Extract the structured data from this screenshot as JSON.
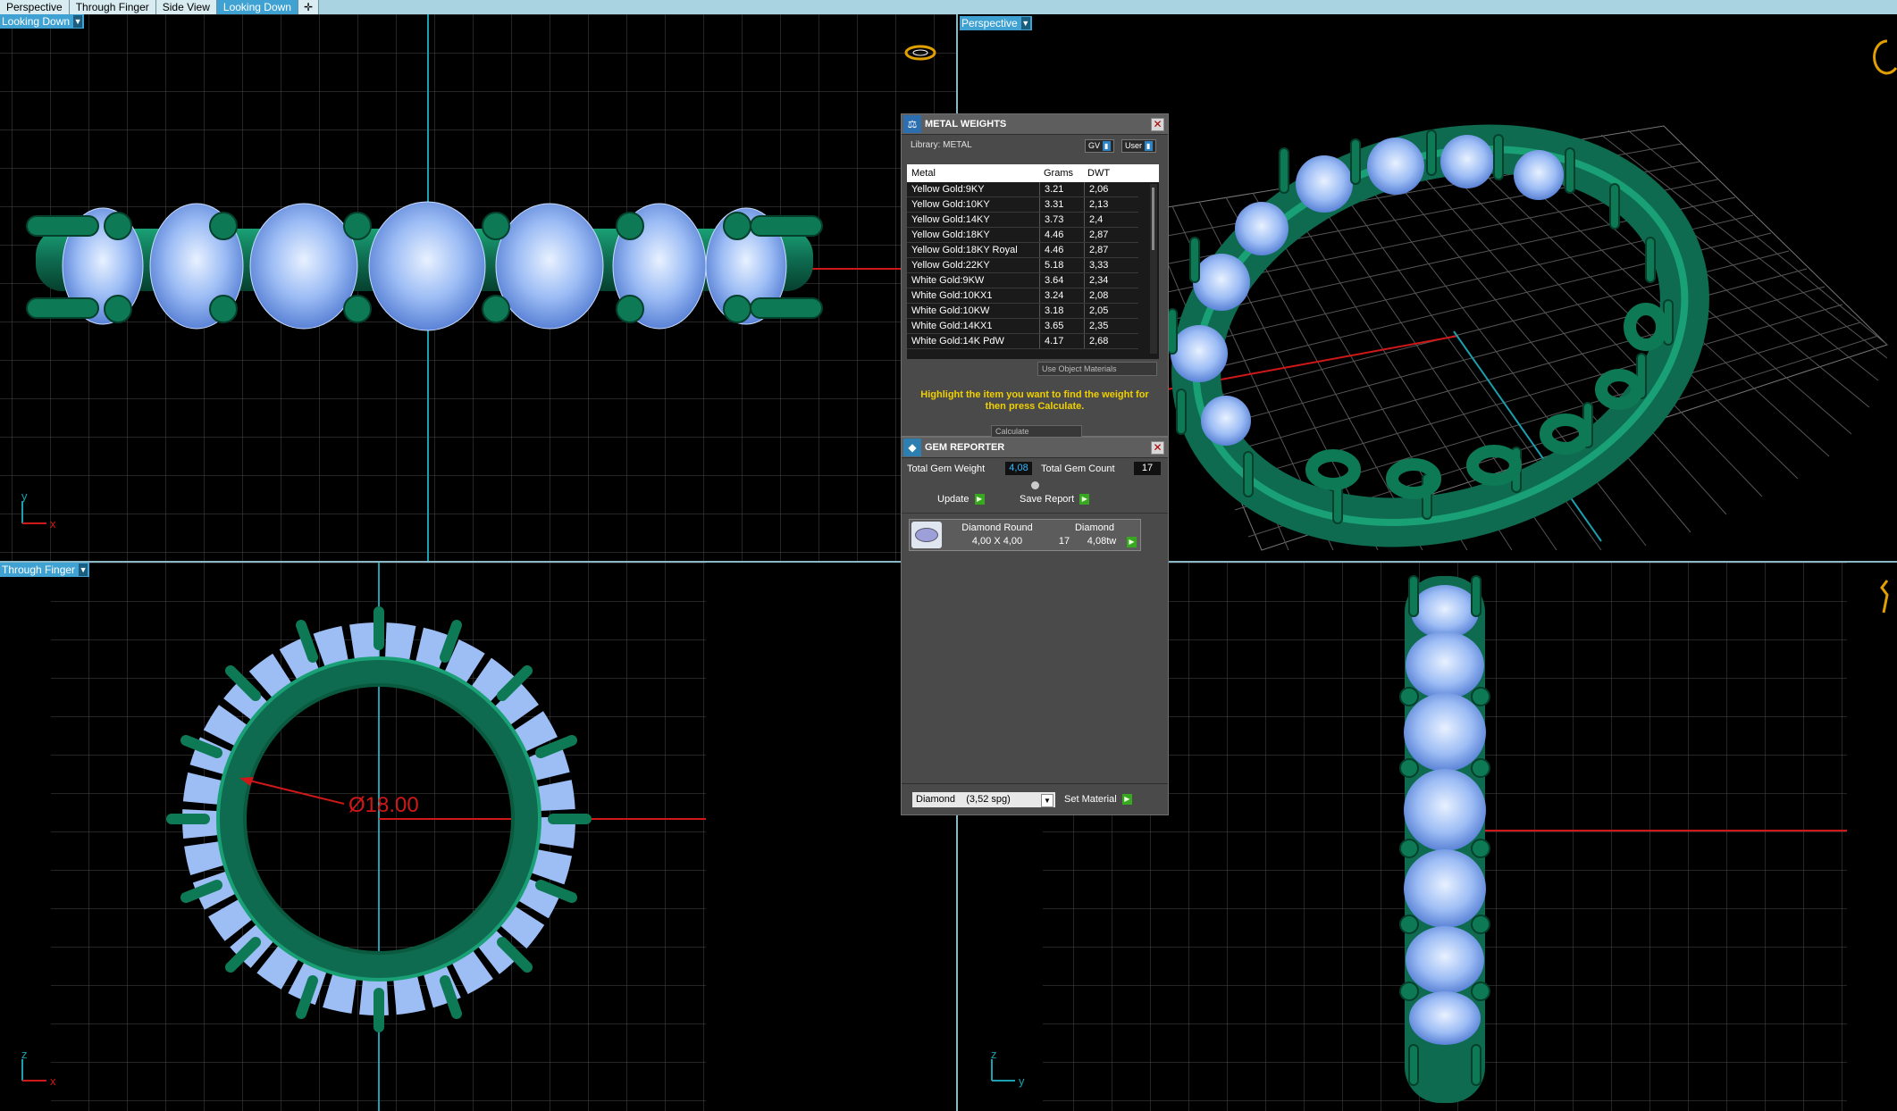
{
  "tabs": [
    {
      "label": "Perspective",
      "active": false
    },
    {
      "label": "Through Finger",
      "active": false
    },
    {
      "label": "Side View",
      "active": false
    },
    {
      "label": "Looking Down",
      "active": true
    }
  ],
  "viewports": {
    "top_left": {
      "label": "Looking Down",
      "axis_v": "y",
      "axis_h": "x"
    },
    "top_right": {
      "label": "Perspective"
    },
    "bottom_left": {
      "label": "Through Finger",
      "axis_v": "z",
      "axis_h": "x",
      "dimension": "Ø18.00"
    },
    "bottom_right": {
      "axis_v": "z",
      "axis_h": "y"
    }
  },
  "metal_weights": {
    "title": "METAL WEIGHTS",
    "library": "Library: METAL",
    "toggle_gv": "GV",
    "toggle_user": "User",
    "columns": [
      "Metal",
      "Grams",
      "DWT"
    ],
    "rows": [
      [
        "Yellow Gold:9KY",
        "3.21",
        "2,06"
      ],
      [
        "Yellow Gold:10KY",
        "3.31",
        "2,13"
      ],
      [
        "Yellow Gold:14KY",
        "3.73",
        "2,4"
      ],
      [
        "Yellow Gold:18KY",
        "4.46",
        "2,87"
      ],
      [
        "Yellow Gold:18KY Royal",
        "4.46",
        "2,87"
      ],
      [
        "Yellow Gold:22KY",
        "5.18",
        "3,33"
      ],
      [
        "White Gold:9KW",
        "3.64",
        "2,34"
      ],
      [
        "White Gold:10KX1",
        "3.24",
        "2,08"
      ],
      [
        "White Gold:10KW",
        "3.18",
        "2,05"
      ],
      [
        "White Gold:14KX1",
        "3.65",
        "2,35"
      ],
      [
        "White Gold:14K PdW",
        "4.17",
        "2,68"
      ]
    ],
    "use_object_materials": "Use Object Materials",
    "hint": "Highlight the item you want to find the weight for then press Calculate.",
    "calculate": "Calculate"
  },
  "gem_reporter": {
    "title": "GEM REPORTER",
    "total_weight_label": "Total Gem Weight",
    "total_weight_value": "4,08",
    "total_count_label": "Total Gem Count",
    "total_count_value": "17",
    "update": "Update",
    "save_report": "Save Report",
    "gem": {
      "shape": "Diamond Round",
      "size": "4,00 X 4,00",
      "material": "Diamond",
      "count": "17",
      "weight": "4,08tw"
    },
    "material_select": "Diamond    (3,52 spg)",
    "set_material": "Set Material"
  },
  "colors": {
    "metal": "#0e6b4f",
    "gem": "#8fb6f5",
    "grid": "#4a4a4a",
    "axis_red": "#d01818",
    "axis_cyan": "#1aa0b0",
    "tab_active": "#3fa2d2",
    "hint_text": "#f0d000"
  }
}
